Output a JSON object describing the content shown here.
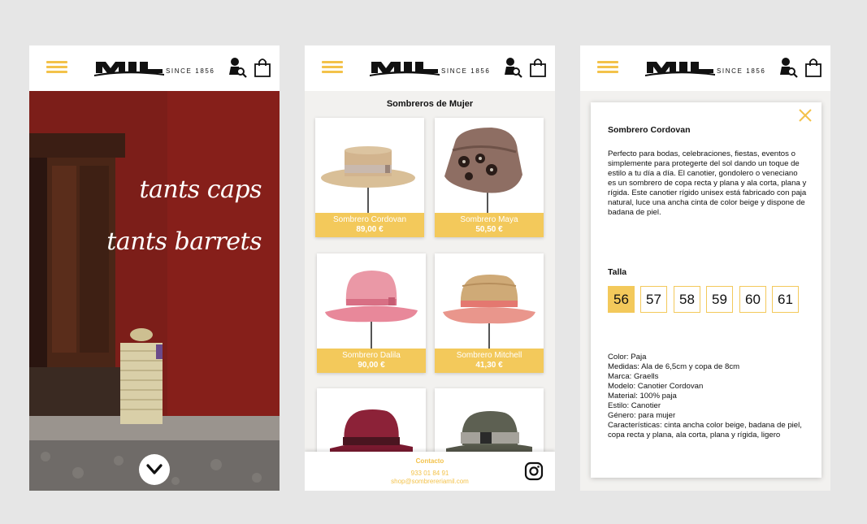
{
  "brand": {
    "logo_text": "MIL",
    "since": "SINCE 1856"
  },
  "colors": {
    "accent": "#f3c24a",
    "card_caption": "#f3c95b",
    "hero_wall": "#7c1e19"
  },
  "icons": {
    "menu": "hamburger-menu-icon",
    "account": "user-search-icon",
    "cart": "shopping-bag-icon",
    "scroll": "chevron-down-icon",
    "close": "close-icon",
    "social": "instagram-icon"
  },
  "hero": {
    "line1": "tants caps",
    "line2": "tants barrets"
  },
  "catalog": {
    "title": "Sombreros de Mujer",
    "products": [
      {
        "name": "Sombrero Cordovan",
        "price": "89,00 €"
      },
      {
        "name": "Sombrero Maya",
        "price": "50,50 €"
      },
      {
        "name": "Sombrero Dalila",
        "price": "90,00 €"
      },
      {
        "name": "Sombrero Mitchell",
        "price": "41,30 €"
      },
      {
        "name": "",
        "price": ""
      },
      {
        "name": "",
        "price": ""
      }
    ],
    "footer": {
      "title": "Contacto",
      "phone": "933 01 84 91",
      "email": "shop@sombrereriamil.com"
    }
  },
  "detail": {
    "title": "Sombrero Cordovan",
    "description": "Perfecto para bodas, celebraciones, fiestas, eventos o simplemente para protegerte del sol dando un toque de estilo a tu día a día. El canotier, gondolero o veneciano es un sombrero de copa recta y plana y ala corta, plana y rígida. Este canotier rígido unisex está fabricado con paja natural, luce una ancha cinta de color beige y dispone de badana de piel.",
    "size_label": "Talla",
    "sizes": [
      "56",
      "57",
      "58",
      "59",
      "60",
      "61"
    ],
    "selected_size": "56",
    "specs": [
      "Color: Paja",
      "Medidas: Ala de 6,5cm y copa de 8cm",
      "Marca: Graells",
      "Modelo: Canotier Cordovan",
      "Material: 100% paja",
      "Estilo: Canotier",
      "Género: para mujer",
      "Características: cinta ancha color beige, badana de piel, copa recta y plana, ala corta, plana y rígida, ligero"
    ]
  }
}
